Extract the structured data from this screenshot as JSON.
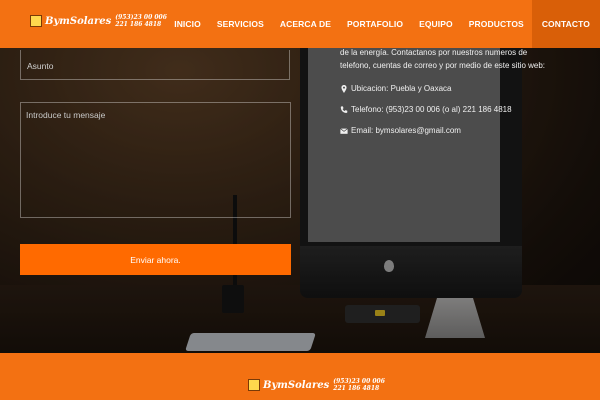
{
  "brand": {
    "name": "BymSolares",
    "phone_line1": "(953)23 00 006",
    "phone_line2": "221 186 4818"
  },
  "nav": {
    "items": [
      "INICIO",
      "SERVICIOS",
      "ACERCA DE",
      "PORTAFOLIO",
      "EQUIPO",
      "PRODUCTOS",
      "CONTACTO"
    ],
    "active": "CONTACTO"
  },
  "form": {
    "subject_placeholder": "Asunto",
    "message_placeholder": "Introduce tu mensaje",
    "submit_label": "Enviar ahora."
  },
  "contact": {
    "intro": "de la energía. Contactanos por nuestros numeros de telefono, cuentas de correo y por medio de este sitio web:",
    "location": "Ubicacion: Puebla y Oaxaca",
    "phone": "Telefono: (953)23 00 006 (o al) 221 186 4818",
    "email": "Email: bymsolares@gmail.com"
  },
  "footer": {
    "brand_name": "BymSolares",
    "phone_line1": "(953)23 00 006",
    "phone_line2": "221 186 4818"
  },
  "colors": {
    "accent": "#f37112",
    "button": "#ff6a00"
  }
}
